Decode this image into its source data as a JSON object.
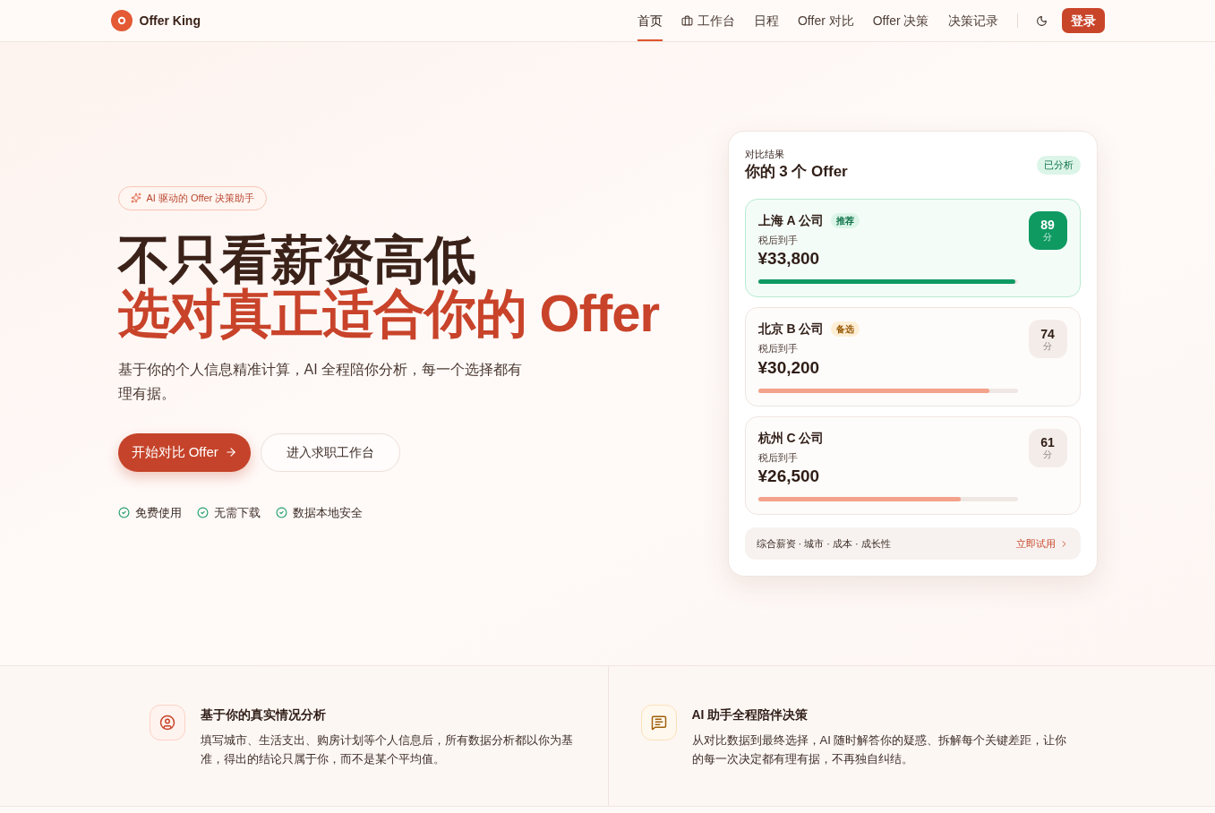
{
  "header": {
    "brand": "Offer King",
    "nav": [
      {
        "label": "首页",
        "selected": true,
        "kind": "plain"
      },
      {
        "label": "工作台",
        "selected": false,
        "kind": "iconed"
      },
      {
        "label": "日程",
        "selected": false,
        "kind": "plain"
      },
      {
        "label": "Offer 对比",
        "selected": false,
        "kind": "plain"
      },
      {
        "label": "Offer 决策",
        "selected": false,
        "kind": "plain"
      },
      {
        "label": "决策记录",
        "selected": false,
        "kind": "plain"
      }
    ],
    "login": "登录"
  },
  "hero": {
    "badge": "AI 驱动的 Offer 决策助手",
    "headline": "不只看薪资高低",
    "headline_accent": "选对真正适合你的 Offer",
    "intro": "基于你的个人信息精准计算，AI 全程陪你分析，每一个选择都有理有据。",
    "primary_button": "开始对比 Offer",
    "secondary_button": "进入求职工作台",
    "perks": [
      "免费使用",
      "无需下载",
      "数据本地安全"
    ]
  },
  "comparison_card": {
    "eyebrow": "对比结果",
    "title": "你的 3 个 Offer",
    "status": "已分析",
    "offers": [
      {
        "company": "上海 A 公司",
        "tag": {
          "text": "推荐",
          "kind": "recommend"
        },
        "caption": "税后到手",
        "amount": "¥33,800",
        "level": 0.99,
        "score": "89",
        "score_unit": "分",
        "highlighted": true
      },
      {
        "company": "北京 B 公司",
        "tag": {
          "text": "备选",
          "kind": "backup"
        },
        "caption": "税后到手",
        "amount": "¥30,200",
        "level": 0.89,
        "score": "74",
        "score_unit": "分",
        "highlighted": false
      },
      {
        "company": "杭州 C 公司",
        "caption": "税后到手",
        "amount": "¥26,500",
        "level": 0.78,
        "score": "61",
        "score_unit": "分",
        "highlighted": false
      }
    ],
    "footer": {
      "criteria": "综合薪资 · 城市 · 成本 · 成长性",
      "link": "立即试用"
    }
  },
  "features": [
    {
      "kind": "profile",
      "title": "基于你的真实情况分析",
      "text": "填写城市、生活支出、购房计划等个人信息后，所有数据分析都以你为基准，得出的结论只属于你，而不是某个平均值。"
    },
    {
      "kind": "assistant",
      "title": "AI 助手全程陪伴决策",
      "text": "从对比数据到最终选择，AI 随时解答你的疑惑、拆解每个关键差距，让你的每一次决定都有理有据，不再独自纠结。"
    }
  ]
}
